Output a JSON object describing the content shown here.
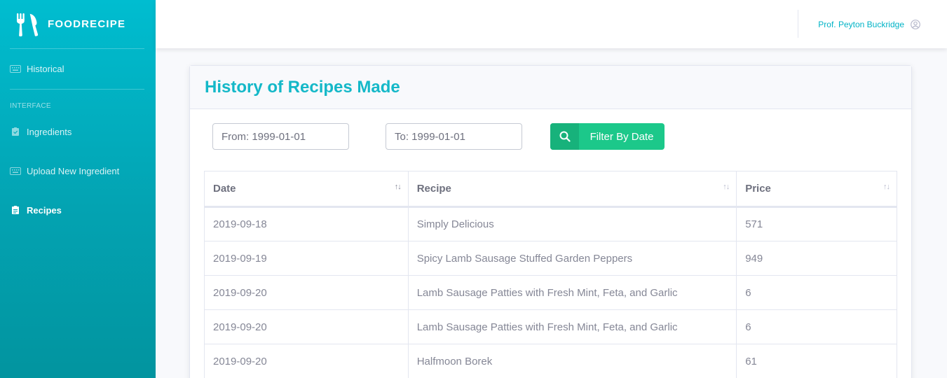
{
  "brand": {
    "name": "FOODRECIPE",
    "icon": "utensils-icon"
  },
  "sidebar": {
    "items": [
      {
        "label": "Historical",
        "icon": "keyboard-icon",
        "active": false
      },
      {
        "label": "Ingredients",
        "icon": "clipboard-check-icon",
        "active": false
      },
      {
        "label": "Upload New Ingredient",
        "icon": "keyboard-icon",
        "active": false
      },
      {
        "label": "Recipes",
        "icon": "clipboard-list-icon",
        "active": true
      }
    ],
    "heading": "INTERFACE"
  },
  "topbar": {
    "user_name": "Prof. Peyton Buckridge",
    "user_icon": "user-circle-icon"
  },
  "card": {
    "title": "History of Recipes Made"
  },
  "filters": {
    "from_placeholder": "From: 1999-01-01",
    "to_placeholder": "To: 1999-01-01",
    "button_label": "Filter By Date",
    "button_icon": "search-icon"
  },
  "table": {
    "headers": [
      "Date",
      "Recipe",
      "Price"
    ],
    "rows": [
      [
        "2019-09-18",
        "Simply Delicious",
        "571"
      ],
      [
        "2019-09-19",
        "Spicy Lamb Sausage Stuffed Garden Peppers",
        "949"
      ],
      [
        "2019-09-20",
        "Lamb Sausage Patties with Fresh Mint, Feta, and Garlic",
        "6"
      ],
      [
        "2019-09-20",
        "Lamb Sausage Patties with Fresh Mint, Feta, and Garlic",
        "6"
      ],
      [
        "2019-09-20",
        "Halfmoon Borek",
        "61"
      ]
    ]
  },
  "colors": {
    "sidebar_top": "#00bdd0",
    "sidebar_bottom": "#02949f",
    "accent": "#14b8c8",
    "success": "#1cc88a"
  }
}
